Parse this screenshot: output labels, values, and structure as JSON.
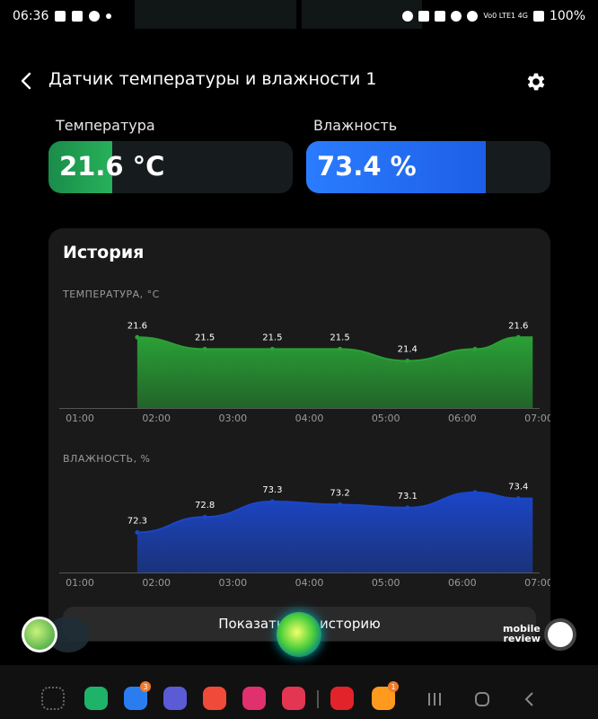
{
  "status_bar": {
    "time": "06:36",
    "network": "Vo0 LTE1 4G",
    "battery": "100%"
  },
  "header": {
    "title": "Датчик температуры и влажности 1",
    "back_icon": "chevron-left-icon",
    "settings_icon": "gear-icon"
  },
  "metrics": {
    "temperature": {
      "label": "Температура",
      "value": "21.6 °C",
      "fill_fraction": 0.26,
      "color": "#27b15a"
    },
    "humidity": {
      "label": "Влажность",
      "value": "73.4 %",
      "fill_fraction": 0.734,
      "color": "#1d5fe6"
    }
  },
  "history": {
    "title": "История",
    "show_button_label": "Показать всю историю"
  },
  "chart_data": [
    {
      "type": "area",
      "title": "ТЕМПЕРАТУРА, °C",
      "x_tick_labels": [
        "01:00",
        "02:00",
        "03:00",
        "04:00",
        "05:00",
        "06:00",
        "07:00"
      ],
      "xlim": [
        "01:00",
        "07:00"
      ],
      "ylim": [
        21.0,
        21.8
      ],
      "x": [
        "01:45",
        "02:38",
        "03:31",
        "04:24",
        "05:17",
        "06:10",
        "06:44"
      ],
      "values": [
        21.6,
        21.5,
        21.5,
        21.5,
        21.4,
        21.5,
        21.6
      ],
      "point_labels": [
        "21.6",
        "21.5",
        "21.5",
        "21.5",
        "21.4",
        "",
        "21.6"
      ],
      "color": "#2aa036"
    },
    {
      "type": "area",
      "title": "ВЛАЖНОСТЬ, %",
      "x_tick_labels": [
        "01:00",
        "02:00",
        "03:00",
        "04:00",
        "05:00",
        "06:00",
        "07:00"
      ],
      "xlim": [
        "01:00",
        "07:00"
      ],
      "ylim": [
        71.0,
        74.0
      ],
      "x": [
        "01:45",
        "02:38",
        "03:31",
        "04:24",
        "05:17",
        "06:10",
        "06:44"
      ],
      "values": [
        72.3,
        72.8,
        73.3,
        73.2,
        73.1,
        73.6,
        73.4
      ],
      "point_labels": [
        "72.3",
        "72.8",
        "73.3",
        "73.2",
        "73.1",
        "",
        "73.4"
      ],
      "color": "#1b46c8"
    }
  ],
  "overlay": {
    "watermark_line1": "mobile",
    "watermark_line2": "review"
  },
  "dock": {
    "items": [
      {
        "name": "app-drawer-icon",
        "color": "#444444"
      },
      {
        "name": "phone-icon",
        "color": "#1db46a"
      },
      {
        "name": "messages-icon",
        "color": "#2a7df0",
        "badge": "3"
      },
      {
        "name": "internet-icon",
        "color": "#5b5bd6"
      },
      {
        "name": "notes-icon",
        "color": "#ef4a3a"
      },
      {
        "name": "gallery-icon",
        "color": "#e0306e"
      },
      {
        "name": "camera-icon",
        "color": "#e23652"
      },
      {
        "name": "rzd-icon",
        "color": "#e3232a"
      },
      {
        "name": "music-icon",
        "color": "#ff9a1f",
        "badge": "1"
      }
    ]
  }
}
